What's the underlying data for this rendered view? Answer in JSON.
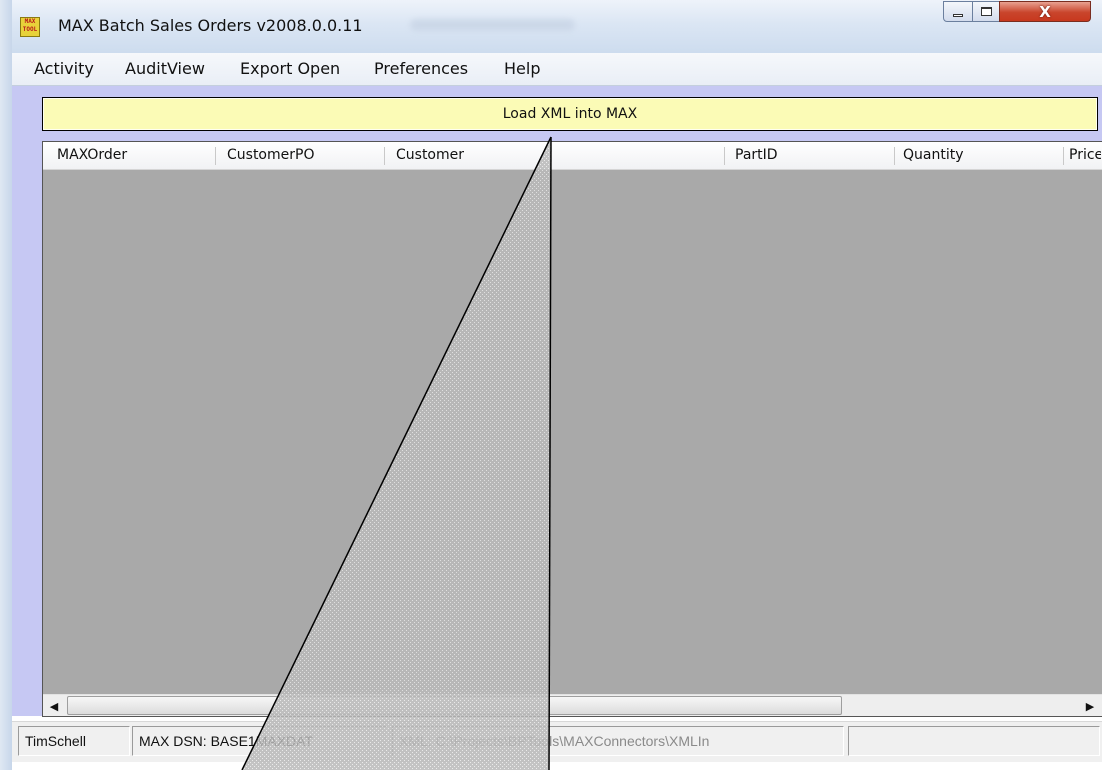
{
  "window": {
    "title": "MAX Batch Sales Orders v2008.0.0.11",
    "icon_text": "MAX TOOL",
    "close_glyph": "X"
  },
  "menu": {
    "items": [
      "Activity",
      "AuditView",
      "Export Open",
      "Preferences",
      "Help"
    ]
  },
  "load_button": {
    "label": "Load XML into MAX"
  },
  "grid": {
    "columns": [
      "MAXOrder",
      "CustomerPO",
      "Customer",
      "PartID",
      "Quantity",
      "Price"
    ],
    "rows": []
  },
  "scrollbar": {
    "left_arrow": "◀",
    "right_arrow": "▶"
  },
  "status": {
    "user": "TimSchell",
    "dsn": "MAX DSN: BASE1MAXDAT",
    "xml_path": "XML: C:\\Projects\\BPTools\\MAXConnectors\\XMLIn",
    "extra": ""
  }
}
